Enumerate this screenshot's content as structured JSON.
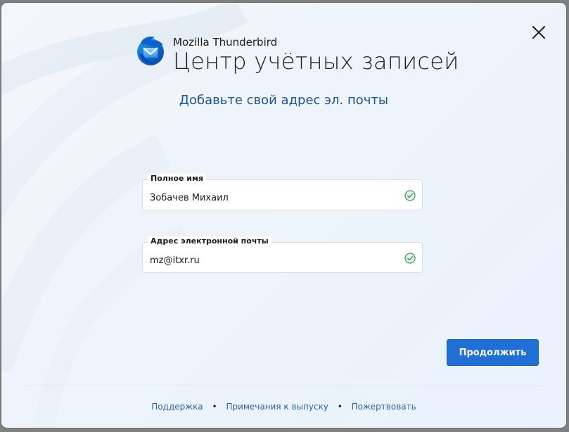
{
  "window": {
    "close_label": "Close"
  },
  "brand": {
    "product": "Mozilla Thunderbird",
    "title": "Центр учётных записей"
  },
  "form": {
    "heading": "Добавьте свой адрес эл. почты",
    "full_name": {
      "label": "Полное имя",
      "value": "Зобачев Михаил",
      "valid": true
    },
    "email": {
      "label": "Адрес электронной почты",
      "value": "mz@itxr.ru",
      "valid": true
    },
    "continue_label": "Продолжить"
  },
  "footer": {
    "links": [
      "Поддержка",
      "Примечания к выпуску",
      "Пожертвовать"
    ],
    "separator": "•"
  },
  "colors": {
    "accent": "#1f6fd6",
    "heading": "#1c5597",
    "link": "#2c63a8",
    "valid": "#3a9a5b"
  },
  "icons": {
    "logo": "thunderbird-logo-icon",
    "close": "close-icon",
    "valid": "checkmark-circle-icon"
  }
}
